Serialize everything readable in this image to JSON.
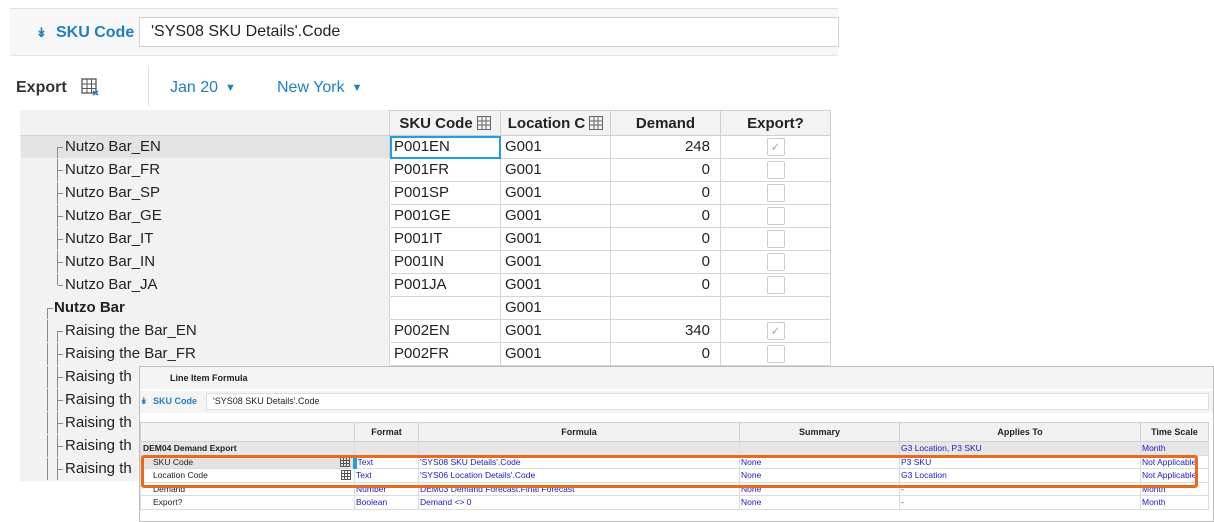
{
  "formula_bar": {
    "label": "SKU Code",
    "value": "'SYS08 SKU Details'.Code"
  },
  "toolbar": {
    "export_label": "Export",
    "time_filter": "Jan 20",
    "location_filter": "New York"
  },
  "grid": {
    "columns": [
      "SKU Code",
      "Location C",
      "Demand",
      "Export?"
    ],
    "rows": [
      {
        "label": "Nutzo Bar_EN",
        "sku": "P001EN",
        "loc": "G001",
        "demand": "248",
        "export": true,
        "level": 1
      },
      {
        "label": "Nutzo Bar_FR",
        "sku": "P001FR",
        "loc": "G001",
        "demand": "0",
        "export": false,
        "level": 1
      },
      {
        "label": "Nutzo Bar_SP",
        "sku": "P001SP",
        "loc": "G001",
        "demand": "0",
        "export": false,
        "level": 1
      },
      {
        "label": "Nutzo Bar_GE",
        "sku": "P001GE",
        "loc": "G001",
        "demand": "0",
        "export": false,
        "level": 1
      },
      {
        "label": "Nutzo Bar_IT",
        "sku": "P001IT",
        "loc": "G001",
        "demand": "0",
        "export": false,
        "level": 1
      },
      {
        "label": "Nutzo Bar_IN",
        "sku": "P001IN",
        "loc": "G001",
        "demand": "0",
        "export": false,
        "level": 1
      },
      {
        "label": "Nutzo Bar_JA",
        "sku": "P001JA",
        "loc": "G001",
        "demand": "0",
        "export": false,
        "level": 1
      },
      {
        "label": "Nutzo Bar",
        "sku": "",
        "loc": "G001",
        "demand": "",
        "export": null,
        "level": 0
      },
      {
        "label": "Raising the Bar_EN",
        "sku": "P002EN",
        "loc": "G001",
        "demand": "340",
        "export": true,
        "level": 1
      },
      {
        "label": "Raising the Bar_FR",
        "sku": "P002FR",
        "loc": "G001",
        "demand": "0",
        "export": false,
        "level": 1
      },
      {
        "label": "Raising th",
        "level": 1
      },
      {
        "label": "Raising th",
        "level": 1
      },
      {
        "label": "Raising th",
        "level": 1
      },
      {
        "label": "Raising th",
        "level": 1
      },
      {
        "label": "Raising th",
        "level": 1
      }
    ]
  },
  "blueprint": {
    "title": "Line Item Formula",
    "formula_bar": {
      "label": "SKU Code",
      "value": "'SYS08 SKU Details'.Code"
    },
    "columns": [
      "",
      "Format",
      "Formula",
      "Summary",
      "Applies To",
      "Time Scale"
    ],
    "module": {
      "name": "DEM04 Demand Export",
      "applies_to": "G3 Location, P3 SKU",
      "time_scale": "Month"
    },
    "rows": [
      {
        "name": "SKU Code",
        "format": "Text",
        "formula": "'SYS08 SKU Details'.Code",
        "summary": "None",
        "applies_to": "P3 SKU",
        "time_scale": "Not Applicable"
      },
      {
        "name": "Location Code",
        "format": "Text",
        "formula": "'SYS06 Location Details'.Code",
        "summary": "None",
        "applies_to": "G3 Location",
        "time_scale": "Not Applicable"
      },
      {
        "name": "Demand",
        "format": "Number",
        "formula": "DEM03 Demand Forecast.Final Forecast",
        "summary": "None",
        "applies_to": "-",
        "time_scale": "Month"
      },
      {
        "name": "Export?",
        "format": "Boolean",
        "formula": "Demand <> 0",
        "summary": "None",
        "applies_to": "-",
        "time_scale": "Month"
      }
    ]
  },
  "colors": {
    "accent": "#1f7fc2",
    "highlight": "#ea6a1c",
    "blueprint_text": "#1a1ac8"
  }
}
